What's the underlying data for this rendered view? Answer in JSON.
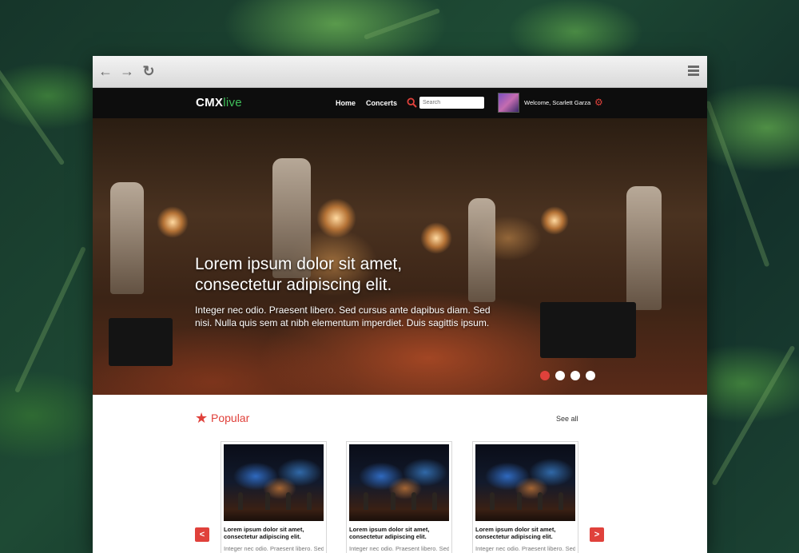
{
  "browser": {
    "back_icon": "arrow-left-icon",
    "forward_icon": "arrow-right-icon",
    "reload_icon": "reload-icon",
    "menu_icon": "hamburger-menu-icon"
  },
  "header": {
    "logo_prefix": "CMX",
    "logo_suffix": "live",
    "nav": [
      {
        "label": "Home"
      },
      {
        "label": "Concerts"
      }
    ],
    "search": {
      "placeholder": "Search",
      "value": ""
    },
    "user": {
      "welcome": "Welcome, Scarlett Garza"
    },
    "accent_color": "#e0413b",
    "logo_accent_color": "#3fbf5a"
  },
  "hero": {
    "title_line1": "Lorem ipsum dolor sit amet,",
    "title_line2": "consectetur adipiscing elit.",
    "text": "Integer nec odio. Praesent libero. Sed cursus ante dapibus diam. Sed nisi. Nulla quis sem at nibh elementum imperdiet. Duis sagittis ipsum.",
    "slides": 4,
    "active_slide": 1
  },
  "popular": {
    "title": "Popular",
    "see_all": "See all",
    "prev": "<",
    "next": ">",
    "cards": [
      {
        "title": "Lorem ipsum dolor sit amet, consectetur adipiscing elit.",
        "text": "Integer nec odio. Praesent libero. Sed"
      },
      {
        "title": "Lorem ipsum dolor sit amet, consectetur adipiscing elit.",
        "text": "Integer nec odio. Praesent libero. Sed"
      },
      {
        "title": "Lorem ipsum dolor sit amet, consectetur adipiscing elit.",
        "text": "Integer nec odio. Praesent libero. Sed"
      }
    ]
  }
}
